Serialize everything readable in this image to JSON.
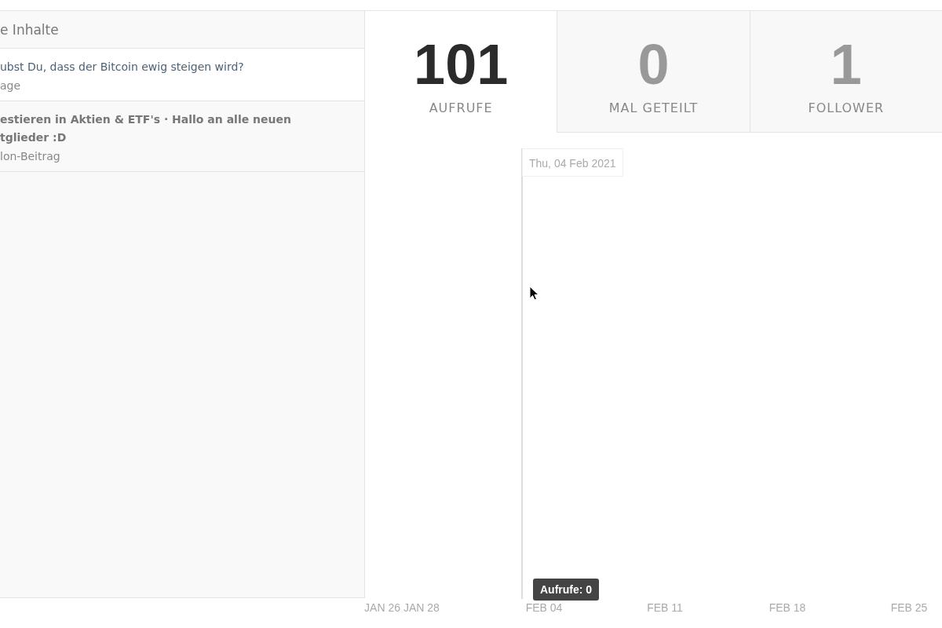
{
  "sidebar": {
    "title": "e Inhalte",
    "items": [
      {
        "title": "ubst Du, dass der Bitcoin ewig steigen wird?",
        "subtitle": "age",
        "selected": true
      },
      {
        "title": "estieren in Aktien & ETF's · Hallo an alle neuen\ntglieder :D",
        "subtitle": "lon-Beitrag",
        "selected": false
      }
    ]
  },
  "stats": [
    {
      "value": "101",
      "label": "AUFRUFE",
      "selected": true
    },
    {
      "value": "0",
      "label": "MAL GETEILT",
      "selected": false
    },
    {
      "value": "1",
      "label": "FOLLOWER",
      "selected": false
    }
  ],
  "chart": {
    "hover_date": "Thu, 04 Feb 2021",
    "tooltip": "Aufrufe: 0",
    "x_labels": [
      "JAN 26",
      "JAN 28",
      "FEB 04",
      "FEB 11",
      "FEB 18",
      "FEB 25"
    ]
  }
}
